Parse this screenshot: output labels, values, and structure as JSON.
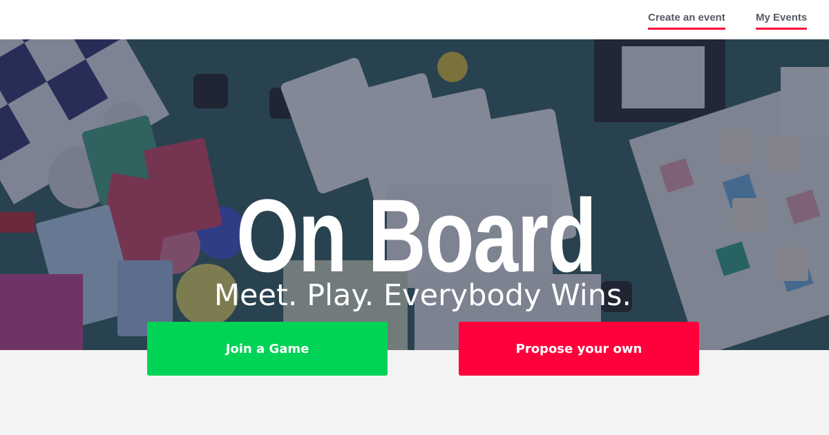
{
  "nav": {
    "create_event_label": "Create an event",
    "my_events_label": "My Events"
  },
  "hero": {
    "title": "On Board",
    "tagline": "Meet. Play. Everybody Wins."
  },
  "actions": {
    "join_label": "Join a Game",
    "propose_label": "Propose your own"
  },
  "colors": {
    "accent_red": "#ff003c",
    "accent_green": "#00d355",
    "nav_text": "#555a64",
    "page_background": "#f3f3f3"
  }
}
